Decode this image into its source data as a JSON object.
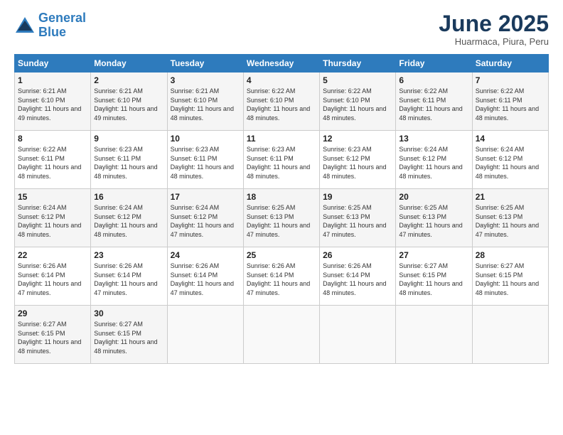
{
  "header": {
    "logo_line1": "General",
    "logo_line2": "Blue",
    "month": "June 2025",
    "location": "Huarmaca, Piura, Peru"
  },
  "days_of_week": [
    "Sunday",
    "Monday",
    "Tuesday",
    "Wednesday",
    "Thursday",
    "Friday",
    "Saturday"
  ],
  "weeks": [
    [
      {
        "day": "1",
        "sunrise": "6:21 AM",
        "sunset": "6:10 PM",
        "daylight": "11 hours and 49 minutes."
      },
      {
        "day": "2",
        "sunrise": "6:21 AM",
        "sunset": "6:10 PM",
        "daylight": "11 hours and 49 minutes."
      },
      {
        "day": "3",
        "sunrise": "6:21 AM",
        "sunset": "6:10 PM",
        "daylight": "11 hours and 48 minutes."
      },
      {
        "day": "4",
        "sunrise": "6:22 AM",
        "sunset": "6:10 PM",
        "daylight": "11 hours and 48 minutes."
      },
      {
        "day": "5",
        "sunrise": "6:22 AM",
        "sunset": "6:10 PM",
        "daylight": "11 hours and 48 minutes."
      },
      {
        "day": "6",
        "sunrise": "6:22 AM",
        "sunset": "6:11 PM",
        "daylight": "11 hours and 48 minutes."
      },
      {
        "day": "7",
        "sunrise": "6:22 AM",
        "sunset": "6:11 PM",
        "daylight": "11 hours and 48 minutes."
      }
    ],
    [
      {
        "day": "8",
        "sunrise": "6:22 AM",
        "sunset": "6:11 PM",
        "daylight": "11 hours and 48 minutes."
      },
      {
        "day": "9",
        "sunrise": "6:23 AM",
        "sunset": "6:11 PM",
        "daylight": "11 hours and 48 minutes."
      },
      {
        "day": "10",
        "sunrise": "6:23 AM",
        "sunset": "6:11 PM",
        "daylight": "11 hours and 48 minutes."
      },
      {
        "day": "11",
        "sunrise": "6:23 AM",
        "sunset": "6:11 PM",
        "daylight": "11 hours and 48 minutes."
      },
      {
        "day": "12",
        "sunrise": "6:23 AM",
        "sunset": "6:12 PM",
        "daylight": "11 hours and 48 minutes."
      },
      {
        "day": "13",
        "sunrise": "6:24 AM",
        "sunset": "6:12 PM",
        "daylight": "11 hours and 48 minutes."
      },
      {
        "day": "14",
        "sunrise": "6:24 AM",
        "sunset": "6:12 PM",
        "daylight": "11 hours and 48 minutes."
      }
    ],
    [
      {
        "day": "15",
        "sunrise": "6:24 AM",
        "sunset": "6:12 PM",
        "daylight": "11 hours and 48 minutes."
      },
      {
        "day": "16",
        "sunrise": "6:24 AM",
        "sunset": "6:12 PM",
        "daylight": "11 hours and 48 minutes."
      },
      {
        "day": "17",
        "sunrise": "6:24 AM",
        "sunset": "6:12 PM",
        "daylight": "11 hours and 47 minutes."
      },
      {
        "day": "18",
        "sunrise": "6:25 AM",
        "sunset": "6:13 PM",
        "daylight": "11 hours and 47 minutes."
      },
      {
        "day": "19",
        "sunrise": "6:25 AM",
        "sunset": "6:13 PM",
        "daylight": "11 hours and 47 minutes."
      },
      {
        "day": "20",
        "sunrise": "6:25 AM",
        "sunset": "6:13 PM",
        "daylight": "11 hours and 47 minutes."
      },
      {
        "day": "21",
        "sunrise": "6:25 AM",
        "sunset": "6:13 PM",
        "daylight": "11 hours and 47 minutes."
      }
    ],
    [
      {
        "day": "22",
        "sunrise": "6:26 AM",
        "sunset": "6:14 PM",
        "daylight": "11 hours and 47 minutes."
      },
      {
        "day": "23",
        "sunrise": "6:26 AM",
        "sunset": "6:14 PM",
        "daylight": "11 hours and 47 minutes."
      },
      {
        "day": "24",
        "sunrise": "6:26 AM",
        "sunset": "6:14 PM",
        "daylight": "11 hours and 47 minutes."
      },
      {
        "day": "25",
        "sunrise": "6:26 AM",
        "sunset": "6:14 PM",
        "daylight": "11 hours and 47 minutes."
      },
      {
        "day": "26",
        "sunrise": "6:26 AM",
        "sunset": "6:14 PM",
        "daylight": "11 hours and 48 minutes."
      },
      {
        "day": "27",
        "sunrise": "6:27 AM",
        "sunset": "6:15 PM",
        "daylight": "11 hours and 48 minutes."
      },
      {
        "day": "28",
        "sunrise": "6:27 AM",
        "sunset": "6:15 PM",
        "daylight": "11 hours and 48 minutes."
      }
    ],
    [
      {
        "day": "29",
        "sunrise": "6:27 AM",
        "sunset": "6:15 PM",
        "daylight": "11 hours and 48 minutes."
      },
      {
        "day": "30",
        "sunrise": "6:27 AM",
        "sunset": "6:15 PM",
        "daylight": "11 hours and 48 minutes."
      },
      null,
      null,
      null,
      null,
      null
    ]
  ]
}
